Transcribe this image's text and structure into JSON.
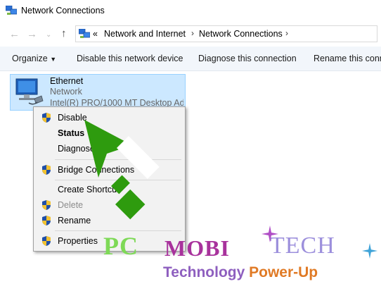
{
  "window": {
    "title": "Network Connections"
  },
  "nav": {
    "back_icon": "arrow-left-icon",
    "forward_icon": "arrow-right-icon",
    "recent_icon": "chevron-down-icon",
    "up_icon": "arrow-up-icon",
    "breadcrumb_prefix": "«",
    "breadcrumbs": [
      "Network and Internet",
      "Network Connections"
    ]
  },
  "commands": {
    "organize": "Organize",
    "disable_device": "Disable this network device",
    "diagnose": "Diagnose this connection",
    "rename": "Rename this conn"
  },
  "connection": {
    "name": "Ethernet",
    "status": "Network",
    "device": "Intel(R) PRO/1000 MT Desktop Ad..."
  },
  "context_menu": {
    "disable": "Disable",
    "status": "Status",
    "diagnose": "Diagnose",
    "bridge": "Bridge Connections",
    "shortcut": "Create Shortcut",
    "delete": "Delete",
    "rename": "Rename",
    "properties": "Properties"
  },
  "watermark": {
    "pc": "PC",
    "mobi": "MOBI",
    "tech": "TECH",
    "technology": "Technology",
    "powerup": "Power-Up"
  },
  "colors": {
    "selection": "#cce8ff",
    "arrow": "#2e9b0e",
    "command_bar": "#f2f6fb"
  }
}
